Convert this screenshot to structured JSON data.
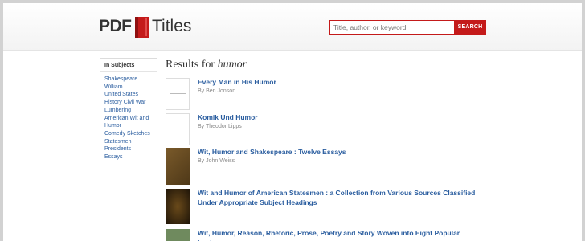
{
  "logo": {
    "pdf": "PDF",
    "titles": "Titles"
  },
  "search": {
    "placeholder": "Title, author, or keyword",
    "button_label": "SEARCH"
  },
  "sidebar": {
    "title": "In Subjects",
    "items": [
      "Shakespeare",
      "William",
      "United States",
      "History Civil War",
      "Lumbering",
      "American Wit and",
      "Humor",
      "Comedy Sketches",
      "Statesmen",
      "Presidents",
      "Essays"
    ]
  },
  "results": {
    "heading_prefix": "Results for",
    "query": "humor",
    "items": [
      {
        "title": "Every Man in His Humor",
        "author": "By Ben Jonson"
      },
      {
        "title": "Komik Und Humor",
        "author": "By Theodor Lipps"
      },
      {
        "title": "Wit, Humor and Shakespeare : Twelve Essays",
        "author": "By John Weiss"
      },
      {
        "title": "Wit and Humor of American Statesmen : a Collection from Various Sources Classified Under Appropriate Subject Headings",
        "author": ""
      },
      {
        "title": "Wit, Humor, Reason, Rhetoric, Prose, Poetry and Story Woven into Eight Popular Lectures",
        "author": ""
      }
    ]
  },
  "colors": {
    "brand_red": "#c41a1a",
    "link_blue": "#2a5d9f"
  }
}
